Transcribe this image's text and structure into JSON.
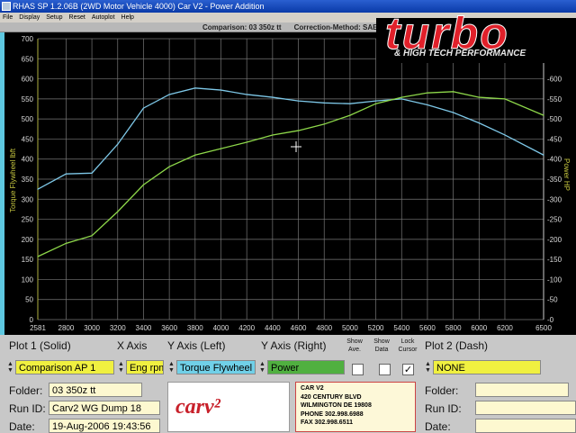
{
  "window": {
    "title": "RHAS SP 1.2.06B  (2WD   Motor Vehicle 4000)   Car V2 - Power Addition"
  },
  "menu": [
    "File",
    "Display",
    "Setup",
    "Reset",
    "Autoplot",
    "Help"
  ],
  "status": {
    "comparison": "Comparison: 03 350z tt",
    "correction": "Correction-Method: SAE"
  },
  "logo": {
    "text": "turbo",
    "subtitle": "& HIGH TECH PERFORMANCE"
  },
  "chart_data": {
    "type": "line",
    "ylabel_left": "Torque Flywheel lbft",
    "ylabel_right": "Power HP",
    "x_ticks": [
      "2581",
      "2800",
      "3000",
      "3200",
      "3400",
      "3600",
      "3800",
      "4000",
      "4200",
      "4400",
      "4600",
      "4800",
      "5000",
      "5200",
      "5400",
      "5600",
      "5800",
      "6000",
      "6200",
      "6500"
    ],
    "y_ticks": [
      "0",
      "50",
      "100",
      "150",
      "200",
      "250",
      "300",
      "350",
      "400",
      "450",
      "500",
      "550",
      "600",
      "650",
      "700"
    ],
    "xlim": [
      2581,
      6500
    ],
    "ylim_left": [
      0,
      700
    ],
    "ylim_right": [
      0,
      700
    ],
    "grid": true,
    "colors": {
      "torque": "#7ec8e8",
      "power": "#8ed84a"
    },
    "x": [
      2581,
      2800,
      3000,
      3200,
      3400,
      3600,
      3800,
      4000,
      4200,
      4400,
      4600,
      4800,
      5000,
      5200,
      5400,
      5600,
      5800,
      6000,
      6200,
      6500
    ],
    "series": [
      {
        "axis": "left",
        "values": [
          325,
          363,
          365,
          437,
          527,
          561,
          577,
          572,
          561,
          554,
          545,
          540,
          538,
          545,
          550,
          535,
          516,
          490,
          460,
          410
        ]
      },
      {
        "axis": "right",
        "values": [
          157,
          190,
          209,
          269,
          336,
          381,
          410,
          426,
          442,
          460,
          471,
          487,
          509,
          538,
          554,
          565,
          568,
          554,
          550,
          509
        ]
      }
    ]
  },
  "panel": {
    "plot1_label": "Plot 1 (Solid)",
    "xaxis_label": "X Axis",
    "yleft_label": "Y Axis (Left)",
    "yright_label": "Y Axis (Right)",
    "show_ave": "Show Ave.",
    "show_data": "Show Data",
    "lock_cursor": "Lock Cursor",
    "plot2_label": "Plot 2 (Dash)",
    "plot1_value": "Comparison AP 1",
    "xaxis_value": "Eng rpm",
    "yleft_value": "Torque Flywheel",
    "yright_value": "Power",
    "plot2_value": "NONE",
    "folder_label": "Folder:",
    "runid_label": "Run ID:",
    "date_label": "Date:",
    "folder1": "03 350z tt",
    "runid1": "Carv2 WG Dump 18",
    "date1": "19-Aug-2006  19:43:56",
    "folder2": "",
    "runid2": "",
    "date2": "",
    "check_mark": "✓",
    "carv2_logo": "carv2.com",
    "address": [
      "CAR V2",
      "420 CENTURY BLVD",
      "WILMINGTON DE 19808",
      "PHONE 302.998.6988",
      "FAX 302.998.6511"
    ]
  }
}
